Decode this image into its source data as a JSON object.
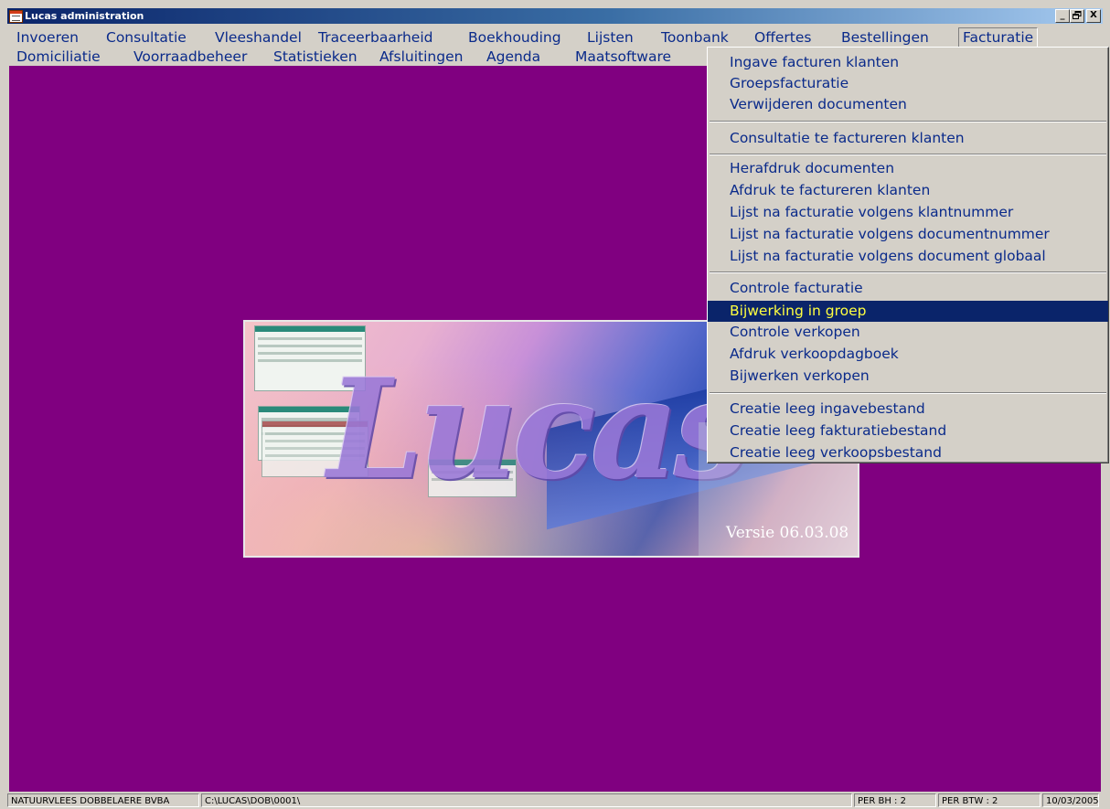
{
  "window": {
    "title": "Lucas administration",
    "buttons": {
      "minimize": "_",
      "maximize": "🗗",
      "close": "X"
    }
  },
  "menubar": {
    "row1": [
      "Invoeren",
      "Consultatie",
      "Vleeshandel",
      "Traceerbaarheid",
      "Boekhouding",
      "Lijsten",
      "Toonbank",
      "Offertes",
      "Bestellingen",
      "Facturatie"
    ],
    "row2": [
      "Domiciliatie",
      "Voorraadbeheer",
      "Statistieken",
      "Afsluitingen",
      "Agenda",
      "Maatsoftware"
    ],
    "active": "Facturatie"
  },
  "dropdown": {
    "groups": [
      [
        "Ingave facturen klanten",
        "Groepsfacturatie",
        "Verwijderen documenten"
      ],
      [
        "Consultatie te factureren klanten"
      ],
      [
        "Herafdruk documenten",
        "Afdruk te factureren klanten",
        "Lijst na facturatie volgens klantnummer",
        "Lijst na facturatie volgens documentnummer",
        "Lijst na facturatie volgens document globaal"
      ],
      [
        "Controle facturatie",
        "Bijwerking in groep",
        "Controle verkopen",
        "Afdruk verkoopdagboek",
        "Bijwerken verkopen"
      ],
      [
        "Creatie leeg ingavebestand",
        "Creatie leeg fakturatiebestand",
        "Creatie leeg verkoopsbestand"
      ]
    ],
    "highlighted": "Bijwerking in groep"
  },
  "splash": {
    "logo": "Lucas",
    "version": "Versie 06.03.08"
  },
  "statusbar": {
    "company": "NATUURVLEES DOBBELAERE BVBA",
    "path": "C:\\LUCAS\\DOB\\0001\\",
    "per_bh": "PER BH :    2",
    "per_btw": "PER BTW :    2",
    "date": "10/03/2005"
  },
  "colors": {
    "workspace": "#800080",
    "menu_text": "#0a2a8a",
    "highlight_bg": "#0a246a",
    "highlight_text": "#ffff40"
  }
}
